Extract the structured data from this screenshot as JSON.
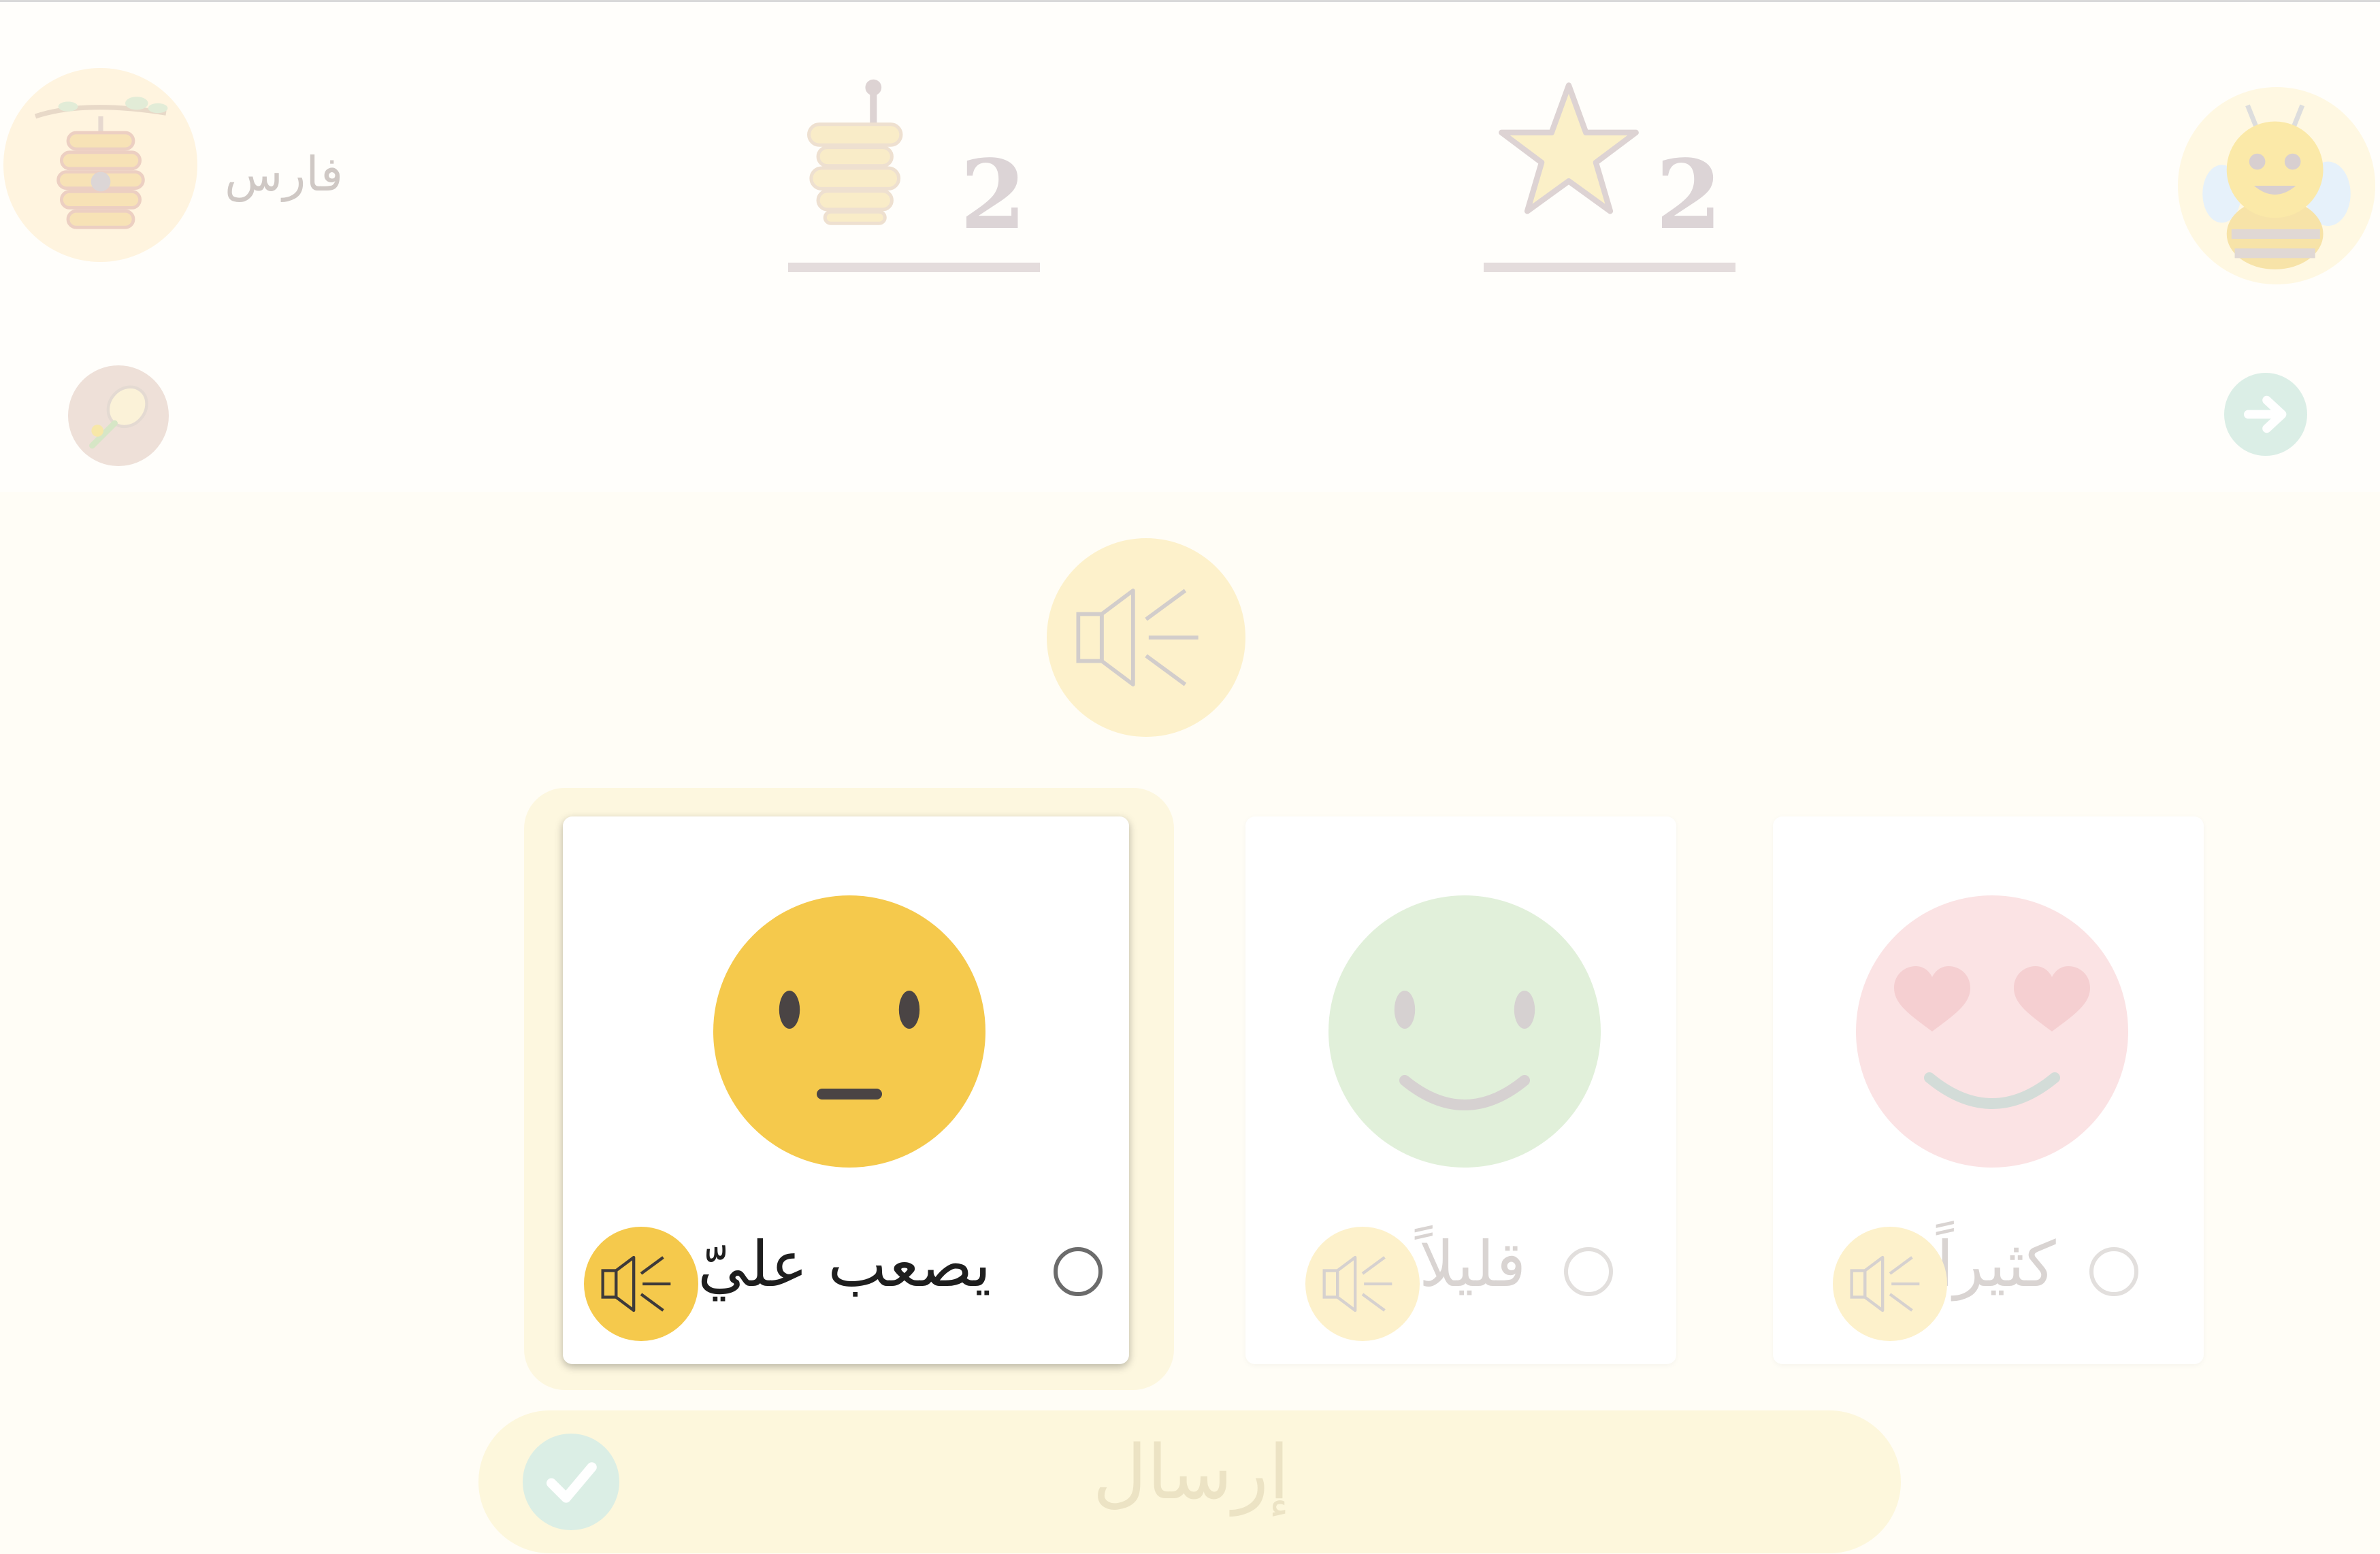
{
  "header": {
    "player_name": "فارس",
    "honey_count": "2",
    "star_count": "2"
  },
  "options": [
    {
      "label": "يصعب عليّ",
      "face": "neutral",
      "selected": true
    },
    {
      "label": "قليلاً",
      "face": "smile",
      "selected": false
    },
    {
      "label": "كثيراً",
      "face": "heart-eyes",
      "selected": false
    }
  ],
  "submit": {
    "label": "إرسال"
  },
  "colors": {
    "accent_yellow": "#f5c94c",
    "dim_yellow": "#fdf1cb",
    "background": "#fffdf6",
    "next_button": "#dbeee6"
  },
  "icons": {
    "beehive": "beehive-icon",
    "honey_dipper": "honey-dipper-icon",
    "star": "star-icon",
    "bee": "bee-icon",
    "tennis": "tennis-racket-icon",
    "next": "arrow-right-icon",
    "speaker": "speaker-icon",
    "check": "check-icon"
  }
}
